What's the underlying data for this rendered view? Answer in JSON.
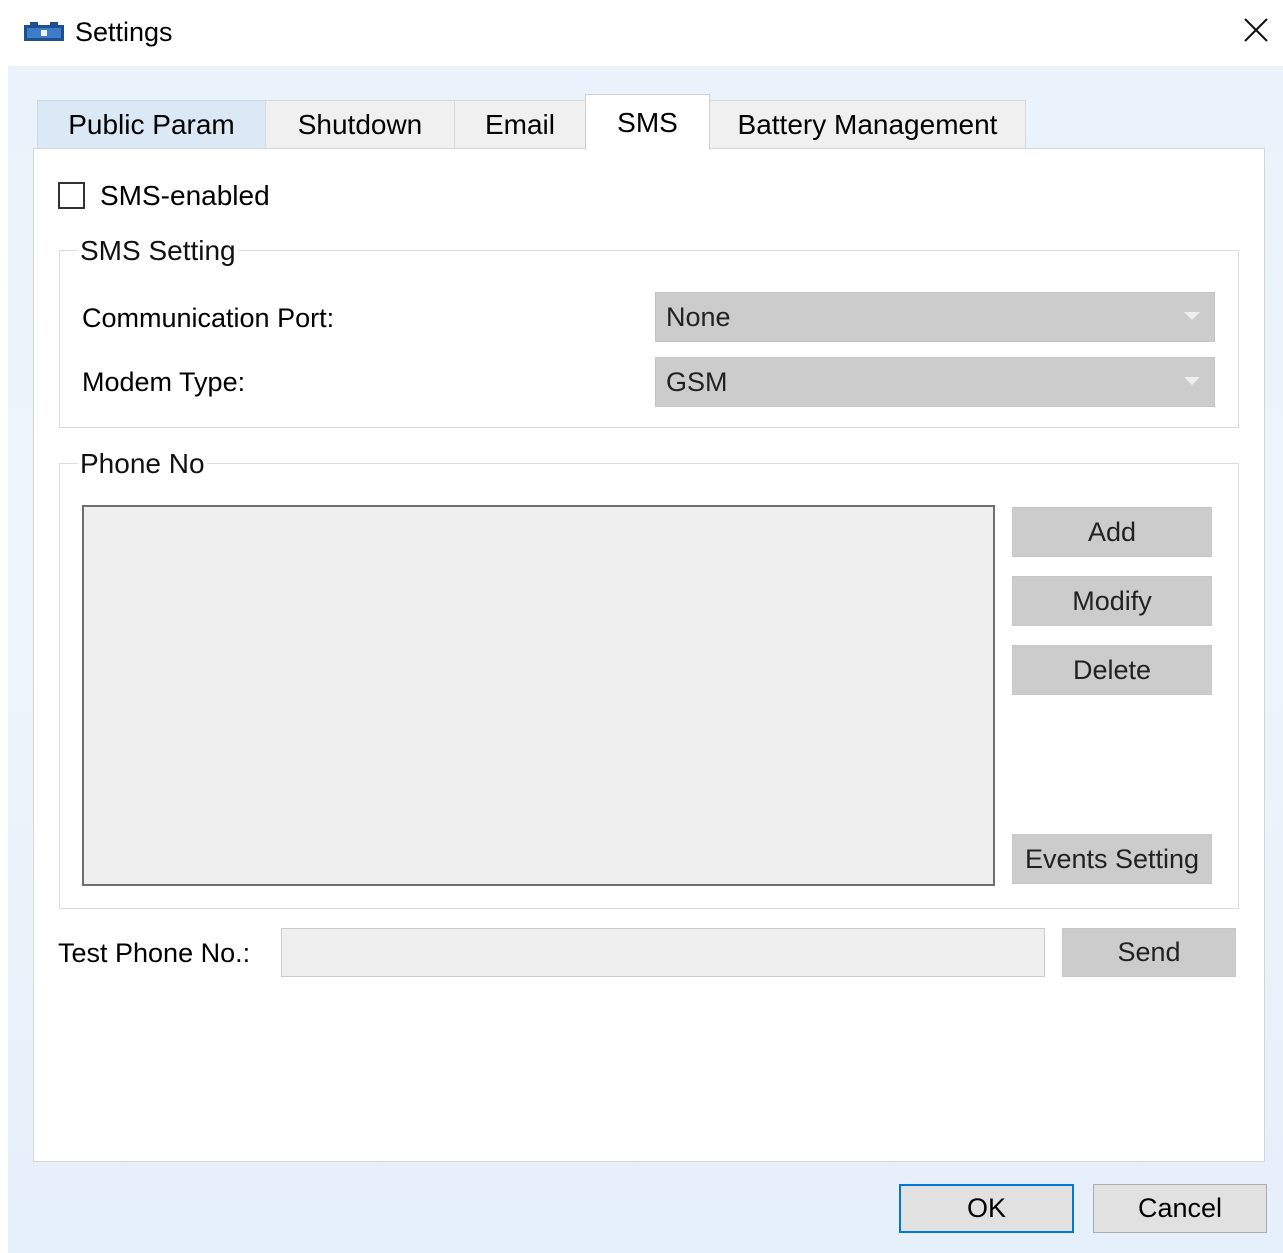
{
  "window": {
    "title": "Settings",
    "icon": "battery-app-icon",
    "close_icon": "close-icon"
  },
  "tabs": [
    {
      "label": "Public Param",
      "active": false
    },
    {
      "label": "Shutdown",
      "active": false
    },
    {
      "label": "Email",
      "active": false
    },
    {
      "label": "SMS",
      "active": true
    },
    {
      "label": "Battery Management",
      "active": false
    }
  ],
  "sms": {
    "enabled_label": "SMS-enabled",
    "enabled_checked": false,
    "setting_group": {
      "legend": "SMS Setting",
      "comm_port_label": "Communication Port:",
      "comm_port_value": "None",
      "modem_type_label": "Modem Type:",
      "modem_type_value": "GSM"
    },
    "phone_group": {
      "legend": "Phone No",
      "entries": [],
      "add_label": "Add",
      "modify_label": "Modify",
      "delete_label": "Delete",
      "events_label": "Events Setting"
    },
    "test": {
      "label": "Test Phone No.:",
      "value": "",
      "send_label": "Send"
    }
  },
  "footer": {
    "ok_label": "OK",
    "cancel_label": "Cancel"
  },
  "colors": {
    "accent": "#0078d7",
    "disabled_control": "#cccccc",
    "client_background": "#eaf3fb"
  }
}
